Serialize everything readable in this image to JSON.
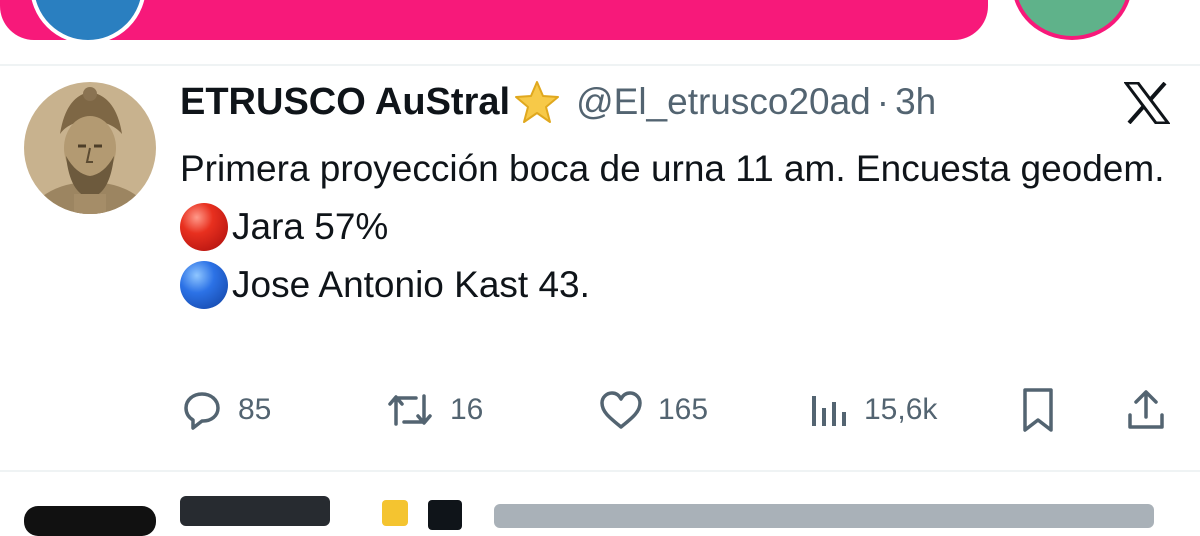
{
  "tweet": {
    "display_name": "ETRUSCO AuStral",
    "name_emoji": "star-emoji",
    "handle": "@El_etrusco20ad",
    "separator": "·",
    "time": "3h",
    "platform_logo": "x-logo",
    "text_lines": [
      "Primera proyección boca de urna 11 am. Encuesta geodem."
    ],
    "results": [
      {
        "emoji": "red-circle-emoji",
        "text": "Jara 57%",
        "color": "#e8301f"
      },
      {
        "emoji": "blue-circle-emoji",
        "text": "Jose Antonio Kast 43.",
        "color": "#2c72e6"
      }
    ]
  },
  "actions": {
    "reply_count": "85",
    "retweet_count": "16",
    "like_count": "165",
    "views_count": "15,6k"
  },
  "colors": {
    "banner": "#f7197a",
    "text_primary": "#0f1419",
    "text_secondary": "#536471",
    "divider": "#eff3f4"
  }
}
